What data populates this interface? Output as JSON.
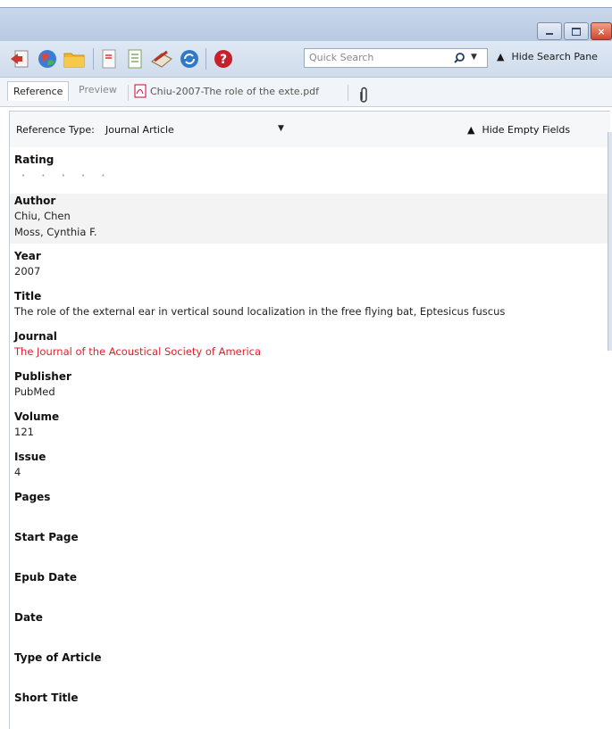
{
  "window": {
    "buttons": [
      {
        "name": "minimize"
      },
      {
        "name": "maximize"
      },
      {
        "name": "close"
      }
    ]
  },
  "toolbar": {
    "search": {
      "placeholder": "Quick Search"
    },
    "hide_search_label": "Hide Search Pane"
  },
  "tabs": {
    "reference": "Reference",
    "preview": "Preview",
    "pdf": "Chiu-2007-The role of the exte.pdf"
  },
  "reference_type": {
    "label": "Reference Type:",
    "value": "Journal Article",
    "hide_empty_label": "Hide Empty Fields"
  },
  "fields": {
    "rating": {
      "label": "Rating"
    },
    "author": {
      "label": "Author",
      "values": [
        "Chiu, Chen",
        "Moss, Cynthia F."
      ]
    },
    "year": {
      "label": "Year",
      "value": "2007"
    },
    "title": {
      "label": "Title",
      "value": "The role of the external ear in vertical sound localization in the free flying bat, Eptesicus fuscus"
    },
    "journal": {
      "label": "Journal",
      "value": "The Journal of the Acoustical Society of America",
      "color": "#e01e2e"
    },
    "publisher": {
      "label": "Publisher",
      "value": "PubMed"
    },
    "volume": {
      "label": "Volume",
      "value": "121"
    },
    "issue": {
      "label": "Issue",
      "value": "4"
    },
    "pages": {
      "label": "Pages"
    },
    "start_page": {
      "label": "Start Page"
    },
    "epub_date": {
      "label": "Epub Date"
    },
    "date": {
      "label": "Date"
    },
    "type_of_article": {
      "label": "Type of Article"
    },
    "short_title": {
      "label": "Short Title"
    }
  }
}
